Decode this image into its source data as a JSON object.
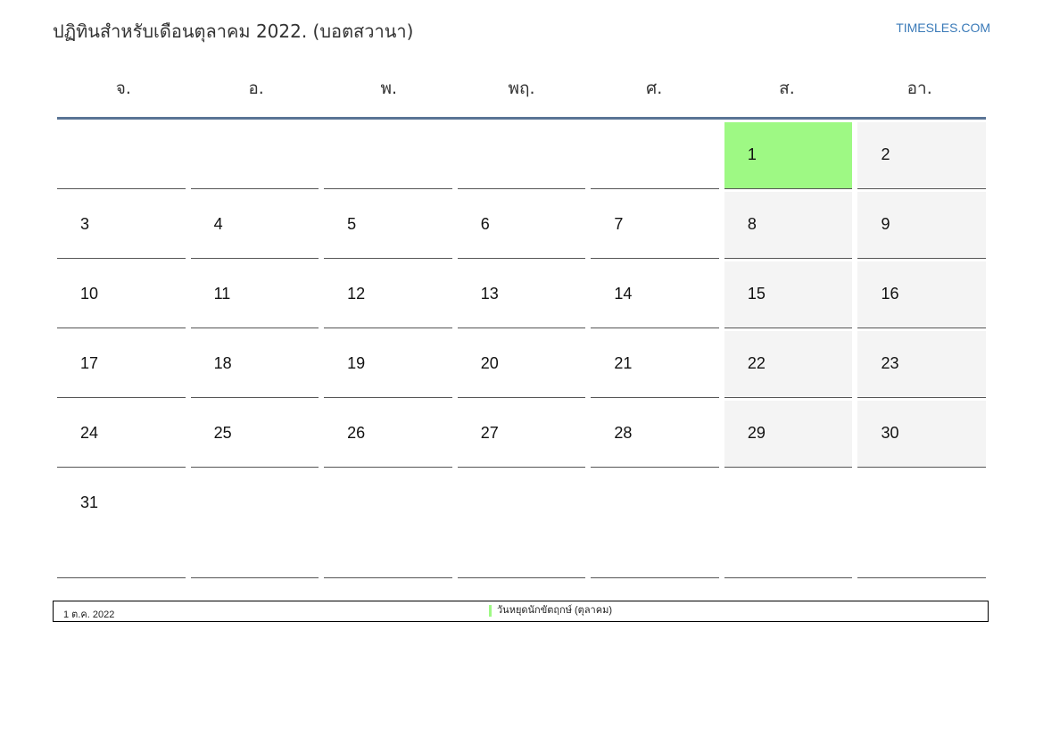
{
  "header": {
    "title": "ปฏิทินสำหรับเดือนตุลาคม 2022. (บอตสวานา)",
    "brand": "TIMESLES.COM"
  },
  "weekdays": [
    "จ.",
    "อ.",
    "พ.",
    "พฤ.",
    "ศ.",
    "ส.",
    "อา."
  ],
  "weeks": [
    [
      "",
      "",
      "",
      "",
      "",
      "1",
      "2"
    ],
    [
      "3",
      "4",
      "5",
      "6",
      "7",
      "8",
      "9"
    ],
    [
      "10",
      "11",
      "12",
      "13",
      "14",
      "15",
      "16"
    ],
    [
      "17",
      "18",
      "19",
      "20",
      "21",
      "22",
      "23"
    ],
    [
      "24",
      "25",
      "26",
      "27",
      "28",
      "29",
      "30"
    ],
    [
      "31",
      "",
      "",
      "",
      "",
      "",
      ""
    ]
  ],
  "highlight_day": "1",
  "legend": {
    "date": "1 ต.ค. 2022",
    "event": "วันหยุดนักขัตฤกษ์ (ตุลาคม)"
  },
  "colors": {
    "holiday": "#9ef984",
    "weekend": "#f4f4f4",
    "header_rule": "#5a7495",
    "brand": "#3a7ab8"
  }
}
